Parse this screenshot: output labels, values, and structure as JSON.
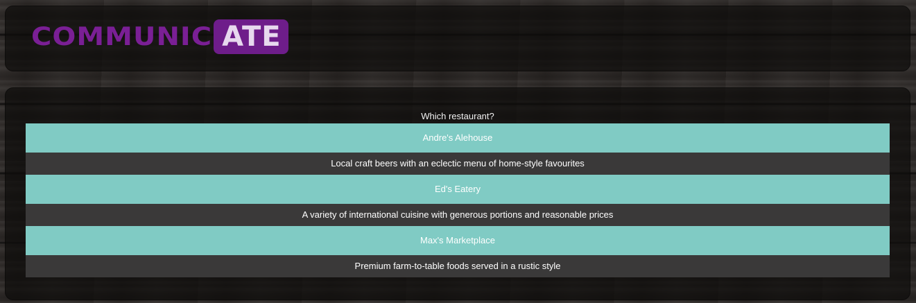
{
  "brand": {
    "logo_left": "COMMUNIC",
    "logo_right": "ATE",
    "primary_color": "#7a1f95"
  },
  "question": "Which restaurant?",
  "restaurants": [
    {
      "name": "Andre's Alehouse",
      "description": "Local craft beers with an eclectic menu of home-style favourites"
    },
    {
      "name": "Ed's Eatery",
      "description": "A variety of international cuisine with generous portions and reasonable prices"
    },
    {
      "name": "Max's Marketplace",
      "description": "Premium farm-to-table foods served in a rustic style"
    }
  ],
  "colors": {
    "option_bg": "#80cbc4",
    "description_bg": "#3a3939"
  }
}
